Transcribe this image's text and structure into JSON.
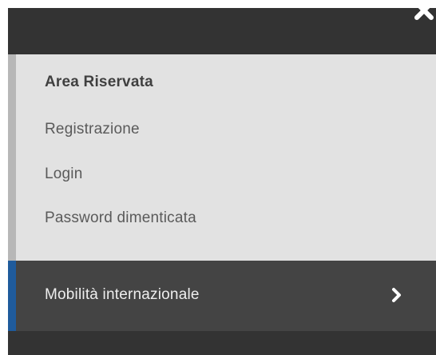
{
  "menu": {
    "close_icon": "close-icon",
    "submenu": {
      "heading": "Area Riservata",
      "links": [
        {
          "label": "Registrazione"
        },
        {
          "label": "Login"
        },
        {
          "label": "Password dimenticata"
        }
      ]
    },
    "nav_item": {
      "label": "Mobilità internazionale",
      "icon": "chevron-right-icon",
      "accent_color": "#1f5b9c"
    }
  }
}
